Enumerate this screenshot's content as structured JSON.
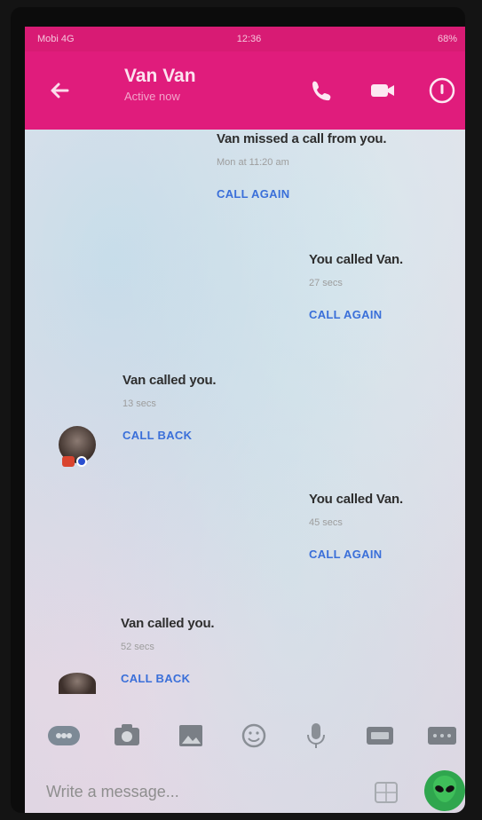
{
  "status_bar": {
    "carrier": "Mobi 4G",
    "time": "12:36",
    "battery": "68%"
  },
  "header": {
    "title": "Van Van",
    "subtitle": "Active now",
    "accent_color": "#e01c7c",
    "icons": {
      "back": "arrow-left-icon",
      "call": "phone-icon",
      "video": "video-camera-icon",
      "info": "info-icon"
    }
  },
  "messages": [
    {
      "side": "right",
      "title": "Van missed a call from you.",
      "detail": "Mon at 11:20 am",
      "action": "CALL AGAIN"
    },
    {
      "side": "right",
      "title": "You called Van.",
      "detail": "27 secs",
      "action": "CALL AGAIN"
    },
    {
      "side": "left",
      "title": "Van called you.",
      "detail": "13 secs",
      "action": "CALL BACK"
    },
    {
      "side": "right",
      "title": "You called Van.",
      "detail": "45 secs",
      "action": "CALL AGAIN"
    },
    {
      "side": "left",
      "title": "Van called you.",
      "detail": "52 secs",
      "action": "CALL BACK"
    }
  ],
  "composer": {
    "placeholder": "Write a message...",
    "toolbar_icons": [
      "grid-apps-icon",
      "camera-icon",
      "gallery-icon",
      "emoji-icon",
      "microphone-icon",
      "gif-icon",
      "more-icon"
    ],
    "send_icon": "alien-emoji-icon",
    "sticker_icon": "sticker-icon"
  }
}
